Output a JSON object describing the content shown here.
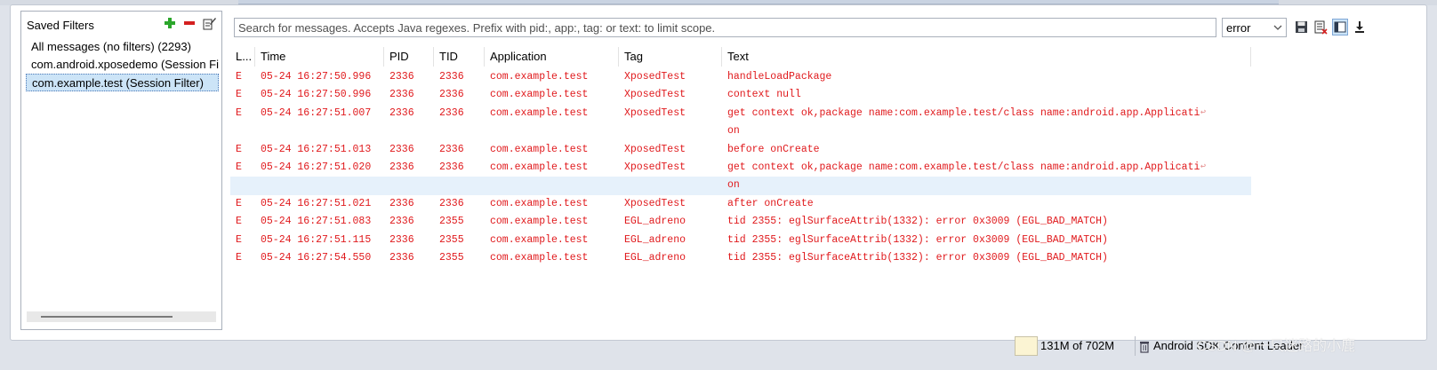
{
  "filters": {
    "title": "Saved Filters",
    "items": [
      {
        "label": "All messages (no filters) (2293)",
        "selected": false
      },
      {
        "label": "com.android.xposedemo (Session Filter)",
        "selected": false
      },
      {
        "label": "com.example.test (Session Filter)",
        "selected": true
      }
    ],
    "icons": [
      "add-icon",
      "remove-icon",
      "edit-icon"
    ]
  },
  "search": {
    "placeholder": "Search for messages. Accepts Java regexes. Prefix with pid:, app:, tag: or text: to limit scope.",
    "value": ""
  },
  "level": {
    "selected": "error"
  },
  "toolbar_icons": [
    "save-icon",
    "clear-log-icon",
    "toggle-column-icon",
    "scroll-lock-icon"
  ],
  "log": {
    "columns": [
      "L...",
      "Time",
      "PID",
      "TID",
      "Application",
      "Tag",
      "Text"
    ],
    "rows": [
      {
        "level": "E",
        "time": "05-24 16:27:50.996",
        "pid": "2336",
        "tid": "2336",
        "app": "com.example.test",
        "tag": "XposedTest",
        "text": "handleLoadPackage",
        "wrap": false
      },
      {
        "level": "E",
        "time": "05-24 16:27:50.996",
        "pid": "2336",
        "tid": "2336",
        "app": "com.example.test",
        "tag": "XposedTest",
        "text": "context null",
        "wrap": false
      },
      {
        "level": "E",
        "time": "05-24 16:27:51.007",
        "pid": "2336",
        "tid": "2336",
        "app": "com.example.test",
        "tag": "XposedTest",
        "text": "get context ok,package name:com.example.test/class name:android.app.Applicati",
        "wrap": true
      },
      {
        "level": "",
        "time": "",
        "pid": "",
        "tid": "",
        "app": "",
        "tag": "",
        "text": "on",
        "wrap": false
      },
      {
        "level": "E",
        "time": "05-24 16:27:51.013",
        "pid": "2336",
        "tid": "2336",
        "app": "com.example.test",
        "tag": "XposedTest",
        "text": "before onCreate",
        "wrap": false
      },
      {
        "level": "E",
        "time": "05-24 16:27:51.020",
        "pid": "2336",
        "tid": "2336",
        "app": "com.example.test",
        "tag": "XposedTest",
        "text": "get context ok,package name:com.example.test/class name:android.app.Applicati",
        "wrap": true
      },
      {
        "level": "",
        "time": "",
        "pid": "",
        "tid": "",
        "app": "",
        "tag": "",
        "text": "on",
        "wrap": false,
        "highlight": true
      },
      {
        "level": "E",
        "time": "05-24 16:27:51.021",
        "pid": "2336",
        "tid": "2336",
        "app": "com.example.test",
        "tag": "XposedTest",
        "text": "after onCreate",
        "wrap": false
      },
      {
        "level": "E",
        "time": "05-24 16:27:51.083",
        "pid": "2336",
        "tid": "2355",
        "app": "com.example.test",
        "tag": "EGL_adreno",
        "text": "tid 2355: eglSurfaceAttrib(1332): error 0x3009 (EGL_BAD_MATCH)",
        "wrap": false
      },
      {
        "level": "E",
        "time": "05-24 16:27:51.115",
        "pid": "2336",
        "tid": "2355",
        "app": "com.example.test",
        "tag": "EGL_adreno",
        "text": "tid 2355: eglSurfaceAttrib(1332): error 0x3009 (EGL_BAD_MATCH)",
        "wrap": false
      },
      {
        "level": "E",
        "time": "05-24 16:27:54.550",
        "pid": "2336",
        "tid": "2355",
        "app": "com.example.test",
        "tag": "EGL_adreno",
        "text": "tid 2355: eglSurfaceAttrib(1332): error 0x3009 (EGL_BAD_MATCH)",
        "wrap": false
      }
    ]
  },
  "status": {
    "memory": "131M of 702M",
    "sdk": "Android SDK Content Loader",
    "watermark": "CSDN @一只迷路的小鹿"
  },
  "colors": {
    "error_text": "#e0191c",
    "selected_bg": "#cce4f7",
    "highlight_row": "#e6f1fb"
  }
}
